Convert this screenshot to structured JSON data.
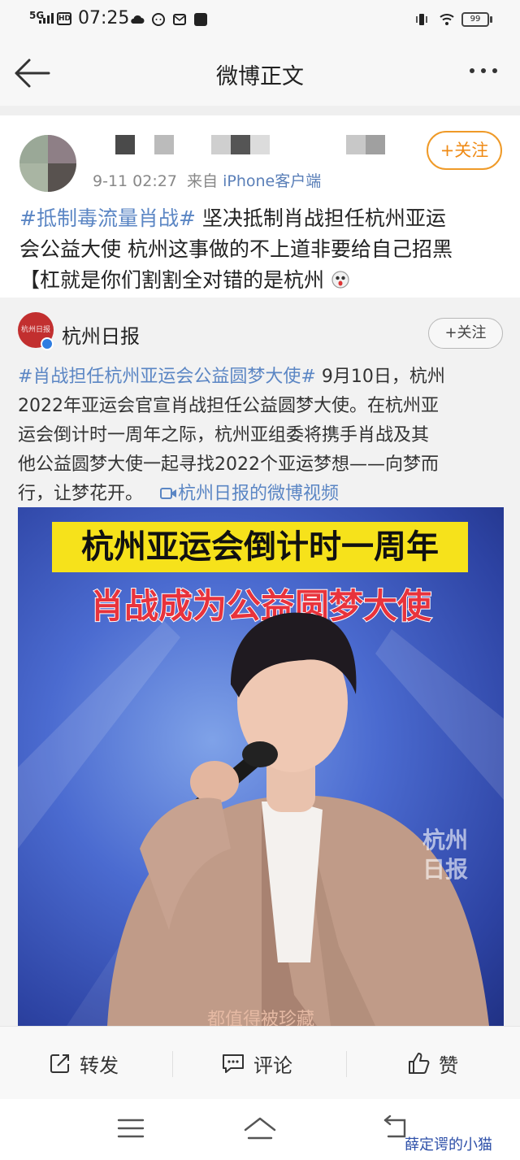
{
  "status_bar": {
    "network": "5G",
    "hd": "HD",
    "time": "07:25",
    "battery": "99"
  },
  "header": {
    "title": "微博正文"
  },
  "post": {
    "meta_time": "9-11 02:27",
    "meta_from": "来自",
    "meta_source": "iPhone客户端",
    "follow_label": "+关注",
    "hashtag": "#抵制毒流量肖战#",
    "body_line1": " 坚决抵制肖战担任杭州亚运",
    "body_line2": "会公益大使 杭州这事做的不上道非要给自己招黑",
    "body_line3": "【杠就是你们割割全对错的是杭州"
  },
  "repost": {
    "author": "杭州日报",
    "avatar_text": "杭州日报",
    "follow_label": "+关注",
    "hashtag": "#肖战担任杭州亚运会公益圆梦大使#",
    "text_line1": " 9月10日，杭州",
    "text_line2": "2022年亚运会官宣肖战担任公益圆梦大使。在杭州亚",
    "text_line3": "运会倒计时一周年之际，杭州亚组委将携手肖战及其",
    "text_line4": "他公益圆梦大使一起寻找2022个亚运梦想——向梦而",
    "text_line5": "行，让梦花开。",
    "video_link": "杭州日报的微博视频"
  },
  "video": {
    "banner_top": "杭州亚运会倒计时一周年",
    "banner_bottom": "肖战成为公益圆梦大使",
    "watermark_line1": "杭州",
    "watermark_line2": "日报",
    "subtitle": "都值得被珍藏"
  },
  "actions": {
    "repost_label": "转发",
    "comment_label": "评论",
    "like_label": "赞"
  },
  "footer_watermark": "薛定谔的小猫",
  "colors": {
    "link_blue": "#5b86c4",
    "follow_orange": "#ef8a14",
    "banner_yellow": "#f6e21b",
    "banner_red": "#e8333c"
  }
}
